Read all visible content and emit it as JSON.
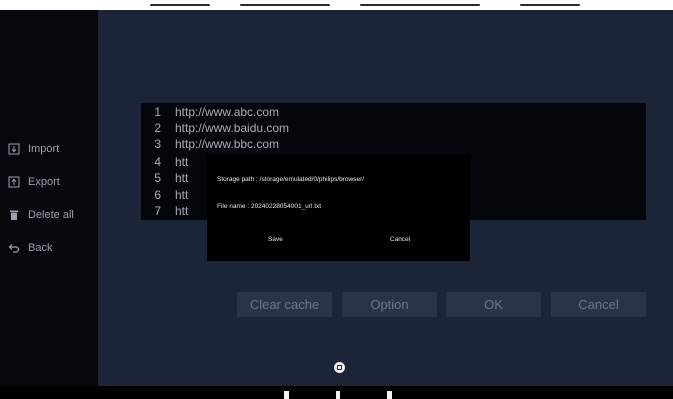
{
  "sidebar": {
    "items": [
      {
        "label": "Import",
        "icon": "import-icon"
      },
      {
        "label": "Export",
        "icon": "export-icon"
      },
      {
        "label": "Delete all",
        "icon": "trash-icon"
      },
      {
        "label": "Back",
        "icon": "back-arrow-icon"
      }
    ]
  },
  "url_list": [
    {
      "num": "1",
      "url": "http://www.abc.com"
    },
    {
      "num": "2",
      "url": "http://www.baidu.com"
    },
    {
      "num": "3",
      "url": "http://www.bbc.com"
    },
    {
      "num": "4",
      "url": "htt"
    },
    {
      "num": "5",
      "url": "htt"
    },
    {
      "num": "6",
      "url": "htt"
    },
    {
      "num": "7",
      "url": "htt"
    }
  ],
  "actions": {
    "clear_cache": "Clear cache",
    "option": "Option",
    "ok": "OK",
    "cancel": "Cancel"
  },
  "dialog": {
    "storage_path": "Storage path : /storage/emulated/0/philips/browser/",
    "file_name": "File name : 20240228054001_url.txt",
    "save": "Save",
    "cancel": "Cancel"
  },
  "colors": {
    "background": "#1c2438",
    "sidebar": "#06080e",
    "list_bg": "#04060b",
    "button_bg": "#2b3346",
    "button_text": "#6f7686",
    "dialog_bg": "#000000"
  }
}
